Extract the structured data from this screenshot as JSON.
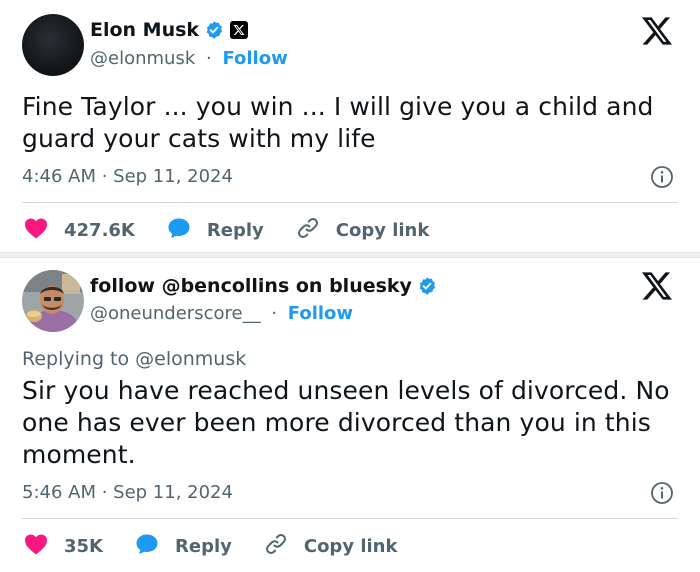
{
  "tweet1": {
    "name": "Elon Musk",
    "handle": "@elonmusk",
    "dot": "·",
    "follow": "Follow",
    "text": "Fine Taylor ... you win ... I will give you a child and guard your cats with my life",
    "time": "4:46 AM · Sep 11, 2024",
    "likes": "427.6K",
    "reply": "Reply",
    "copy_link": "Copy link"
  },
  "tweet2": {
    "name": "follow @bencollins on bluesky",
    "handle": "@oneunderscore__",
    "dot": "·",
    "follow": "Follow",
    "replying_to": "Replying to @elonmusk",
    "text": "Sir you have reached unseen levels of divorced. No one has ever been more divorced than you in this moment.",
    "time": "5:46 AM · Sep 11, 2024",
    "likes": "35K",
    "reply": "Reply",
    "copy_link": "Copy link"
  },
  "colors": {
    "accent": "#1d9bf0",
    "like": "#f91880",
    "muted": "#536471",
    "text": "#0f1419"
  },
  "icons": [
    "verified-badge-icon",
    "x-affiliation-icon",
    "x-logo-icon",
    "info-icon",
    "heart-icon",
    "reply-bubble-icon",
    "link-icon"
  ]
}
